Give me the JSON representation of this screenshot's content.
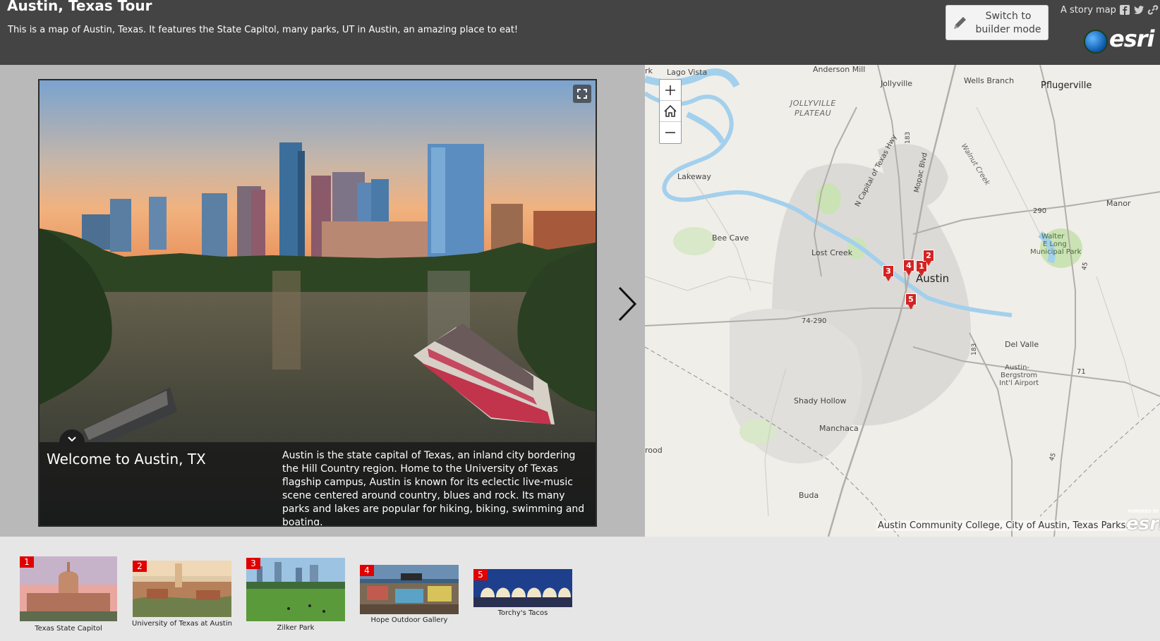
{
  "header": {
    "title": "Austin, Texas Tour",
    "subtitle": "This is a map of Austin, Texas. It features the State Capitol, many parks, UT in Austin, an amazing place to eat!",
    "builder_button_line1": "Switch to",
    "builder_button_line2": "builder mode",
    "story_label": "A story map",
    "brand": "esri",
    "share_icons": [
      "facebook-icon",
      "twitter-icon",
      "link-icon"
    ]
  },
  "slide": {
    "caption_title": "Welcome to Austin, TX",
    "caption_text": "Austin is the state capital of Texas, an inland city bordering the Hill Country region. Home to the University of Texas flagship campus, Austin is known for its eclectic live-music scene centered around country, blues and rock. Its many parks and lakes are popular for hiking, biking, swimming and boating."
  },
  "map": {
    "labels": {
      "lago_vista": "Lago Vista",
      "anderson_mill": "Anderson Mill",
      "jollyville": "Jollyville",
      "wells_branch": "Wells Branch",
      "pflugerville": "Pflugerville",
      "jollyville_plateau_1": "JOLLYVILLE",
      "jollyville_plateau_2": "PLATEAU",
      "lakeway": "Lakeway",
      "walnut_creek": "Walnut Creek",
      "capital_texas_hwy": "N Capital of Texas Hwy",
      "mopac": "Mopac Blvd",
      "manor": "Manor",
      "bee_cave": "Bee Cave",
      "lost_creek": "Lost Creek",
      "walter_park_1": "Walter",
      "walter_park_2": "E Long",
      "walter_park_3": "Municipal Park",
      "austin": "Austin",
      "del_valle": "Del Valle",
      "airport_1": "Austin-",
      "airport_2": "Bergstrom",
      "airport_3": "Int'l Airport",
      "shady_hollow": "Shady Hollow",
      "manchaca": "Manchaca",
      "buda": "Buda",
      "rood": "rood",
      "route_290_west": "74-290",
      "route_290_east": "290",
      "route_183_north": "183",
      "route_183_south": "183",
      "route_71": "71",
      "route_45": "45",
      "route_130": "45",
      "edge_rk": "rk"
    },
    "markers": [
      "1",
      "2",
      "3",
      "4",
      "5"
    ],
    "attribution": "Austin Community College, City of Austin, Texas Parks...",
    "powered_by": "POWERED BY",
    "powered_brand": "esri"
  },
  "carousel": [
    {
      "num": "1",
      "caption": "Texas State Capitol"
    },
    {
      "num": "2",
      "caption": "University of Texas at Austin"
    },
    {
      "num": "3",
      "caption": "Zilker Park"
    },
    {
      "num": "4",
      "caption": "Hope Outdoor Gallery"
    },
    {
      "num": "5",
      "caption": "Torchy's Tacos"
    }
  ]
}
